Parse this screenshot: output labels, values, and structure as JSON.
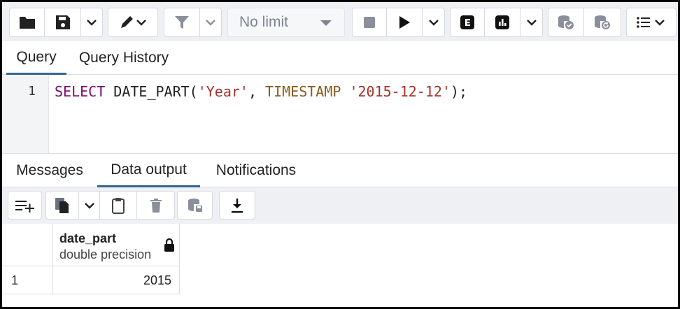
{
  "toolbar": {
    "limit_select": {
      "value": "No limit"
    },
    "icons": [
      "folder-icon",
      "save-icon",
      "chevron-down-icon",
      "pen-icon",
      "filter-icon",
      "stop-icon",
      "play-icon",
      "explain-icon",
      "explain-analyze-icon",
      "commit-icon",
      "rollback-icon",
      "macros-icon"
    ]
  },
  "query_tabs": [
    "Query",
    "Query History"
  ],
  "editor": {
    "line_number": "1",
    "tokens": [
      {
        "text": "SELECT",
        "kind": "kw"
      },
      {
        "text": " DATE_PART(",
        "kind": "plain"
      },
      {
        "text": "'Year'",
        "kind": "str"
      },
      {
        "text": ", ",
        "kind": "plain"
      },
      {
        "text": "TIMESTAMP",
        "kind": "type"
      },
      {
        "text": " ",
        "kind": "plain"
      },
      {
        "text": "'2015-12-12'",
        "kind": "str"
      },
      {
        "text": ");",
        "kind": "plain"
      }
    ]
  },
  "output_tabs": [
    "Messages",
    "Data output",
    "Notifications"
  ],
  "output_toolbar": {
    "icons": [
      "add-row-icon",
      "copy-icon",
      "chevron-down-icon",
      "paste-icon",
      "delete-icon",
      "save-data-icon",
      "download-icon"
    ]
  },
  "grid": {
    "column": {
      "name": "date_part",
      "type": "double precision"
    },
    "rows": [
      {
        "num": "1",
        "value": "2015"
      }
    ]
  },
  "colors": {
    "accent": "#326690",
    "keyword": "#7b0d6f",
    "string": "#a3322a",
    "type": "#8a5a1c"
  }
}
